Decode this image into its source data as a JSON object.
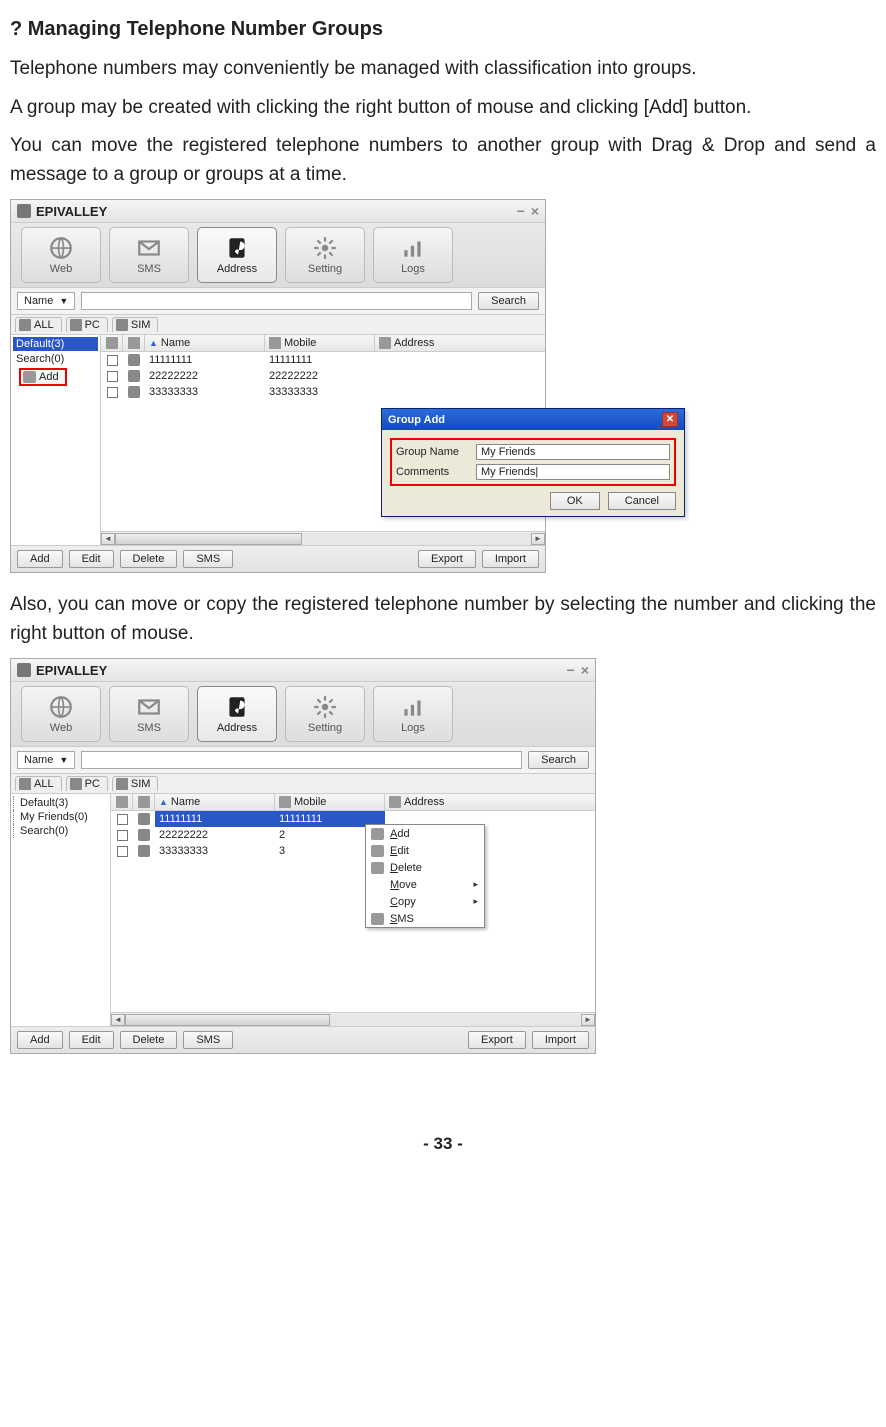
{
  "doc": {
    "heading": "? Managing Telephone Number Groups",
    "para1": "Telephone numbers may conveniently be managed with classification into groups.",
    "para2": "A group may be created with clicking the right button of mouse and clicking [Add] button.",
    "para3": "You can move the registered telephone numbers to another group with Drag & Drop and send a message to a group or groups at a time.",
    "para4": "Also, you can move or copy the registered telephone number by selecting the number and clicking the right button of mouse.",
    "page_number": "- 33 -"
  },
  "app": {
    "title": "EPIVALLEY",
    "toolbar": {
      "web": "Web",
      "sms": "SMS",
      "address": "Address",
      "setting": "Setting",
      "logs": "Logs"
    },
    "search": {
      "dropdown": "Name",
      "button": "Search"
    },
    "tabs": {
      "all": "ALL",
      "pc": "PC",
      "sim": "SIM"
    },
    "cols": {
      "name": "Name",
      "mobile": "Mobile",
      "address": "Address"
    },
    "bottom": {
      "add": "Add",
      "edit": "Edit",
      "delete": "Delete",
      "sms": "SMS",
      "export": "Export",
      "import": "Import"
    }
  },
  "shot1": {
    "side_selected": "Default(3)",
    "side_item": "Search(0)",
    "add_label": "Add",
    "rows": [
      {
        "name": "11111111",
        "mobile": "11111111"
      },
      {
        "name": "22222222",
        "mobile": "22222222"
      },
      {
        "name": "33333333",
        "mobile": "33333333"
      }
    ],
    "dialog": {
      "title": "Group Add",
      "lbl_name": "Group Name",
      "lbl_comments": "Comments",
      "val_name": "My Friends",
      "val_comments": "My Friends|",
      "ok": "OK",
      "cancel": "Cancel"
    }
  },
  "shot2": {
    "side_items": [
      "Default(3)",
      "My Friends(0)",
      "Search(0)"
    ],
    "rows": [
      {
        "name": "11111111",
        "mobile": "11111111"
      },
      {
        "name": "22222222",
        "mobile": "2"
      },
      {
        "name": "33333333",
        "mobile": "3"
      }
    ],
    "ctx": {
      "add": "Add",
      "edit": "Edit",
      "delete": "Delete",
      "move": "Move",
      "copy": "Copy",
      "sms": "SMS"
    }
  }
}
